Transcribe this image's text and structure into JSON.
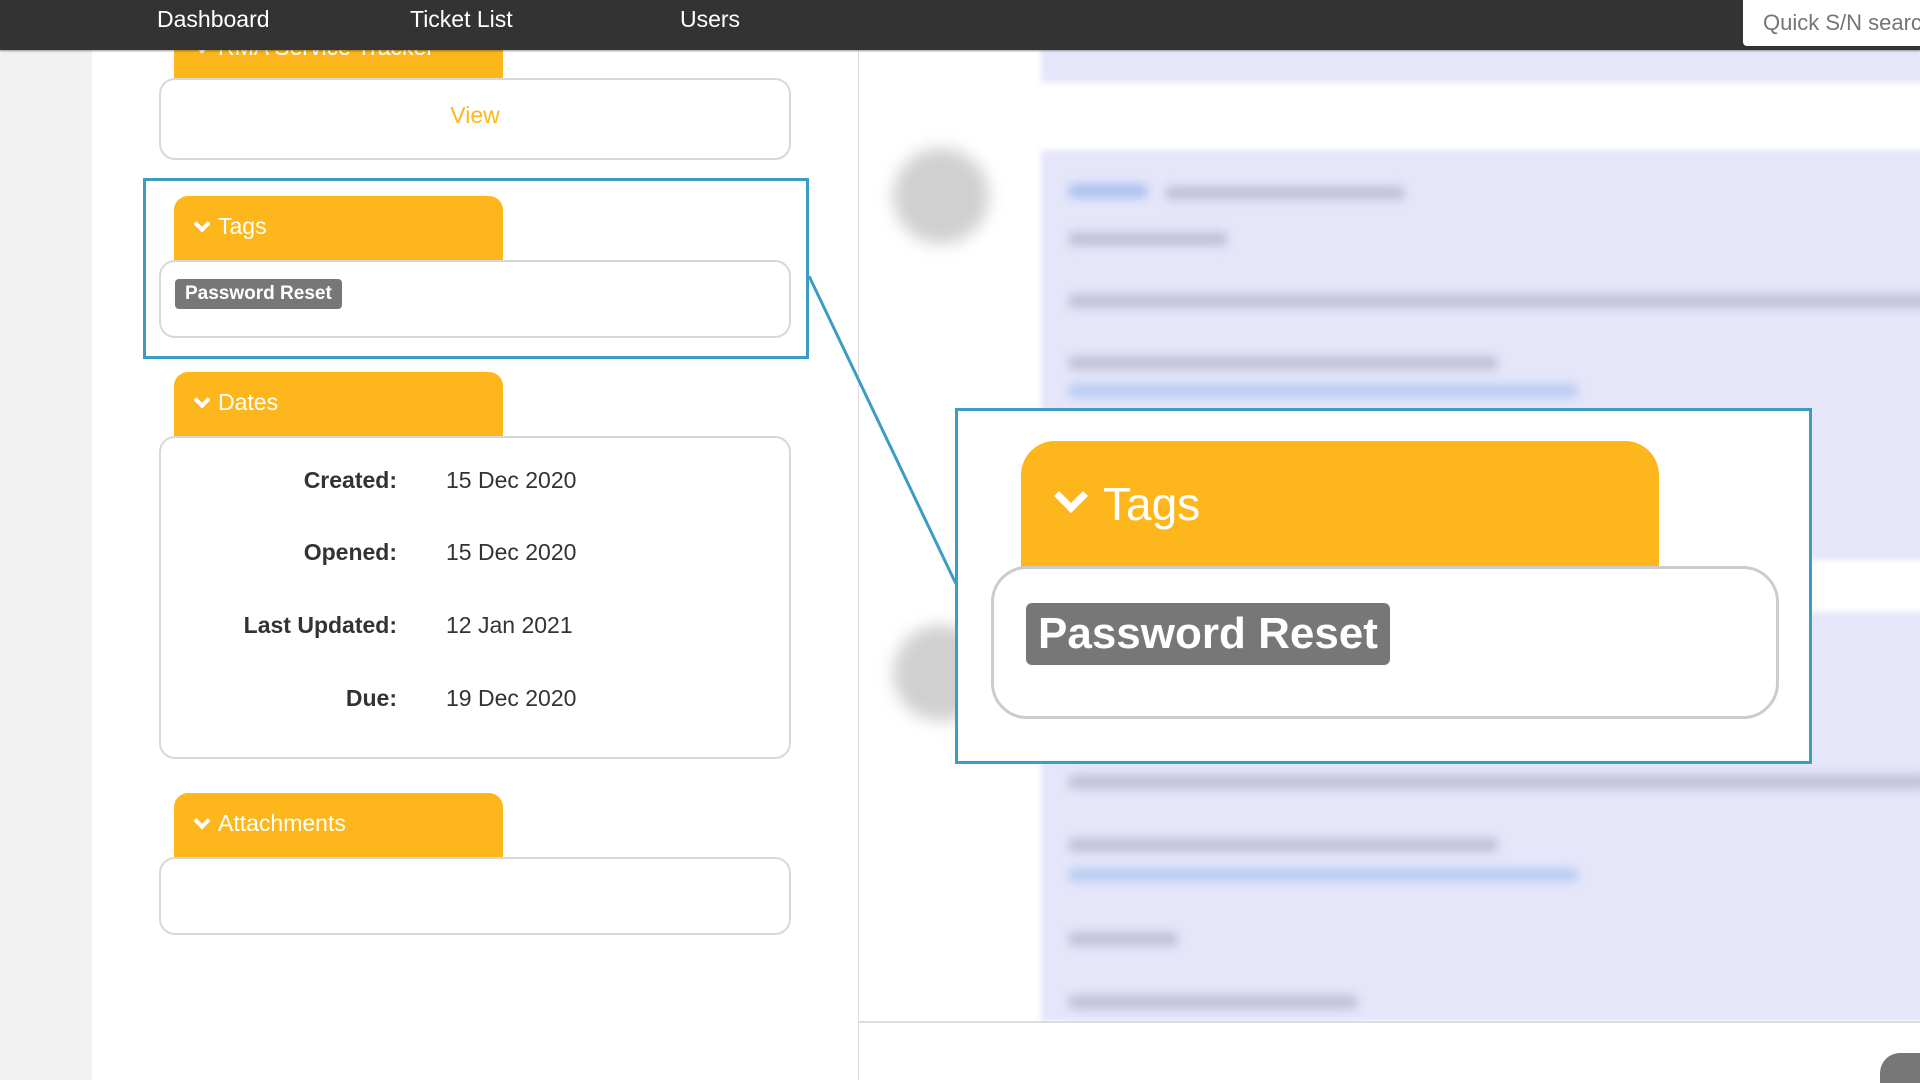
{
  "nav": {
    "items": [
      {
        "label": "Dashboard"
      },
      {
        "label": "Ticket List"
      },
      {
        "label": "Users"
      }
    ],
    "search_placeholder": "Quick S/N search"
  },
  "sidebar": {
    "rma": {
      "title": "RMA Service Tracker",
      "view_label": "View"
    },
    "tags": {
      "title": "Tags",
      "items": [
        "Password Reset"
      ]
    },
    "dates": {
      "title": "Dates",
      "rows": [
        {
          "label": "Created:",
          "value": "15 Dec 2020"
        },
        {
          "label": "Opened:",
          "value": "15 Dec 2020"
        },
        {
          "label": "Last Updated:",
          "value": "12 Jan 2021"
        },
        {
          "label": "Due:",
          "value": "19 Dec 2020"
        }
      ]
    },
    "attachments": {
      "title": "Attachments"
    }
  },
  "callout": {
    "title": "Tags",
    "tag": "Password Reset"
  },
  "colors": {
    "accent": "#fdb71c",
    "highlight": "#3d9cc4",
    "tag": "#777777",
    "nav": "#333333",
    "message": "#e6e6fb"
  }
}
